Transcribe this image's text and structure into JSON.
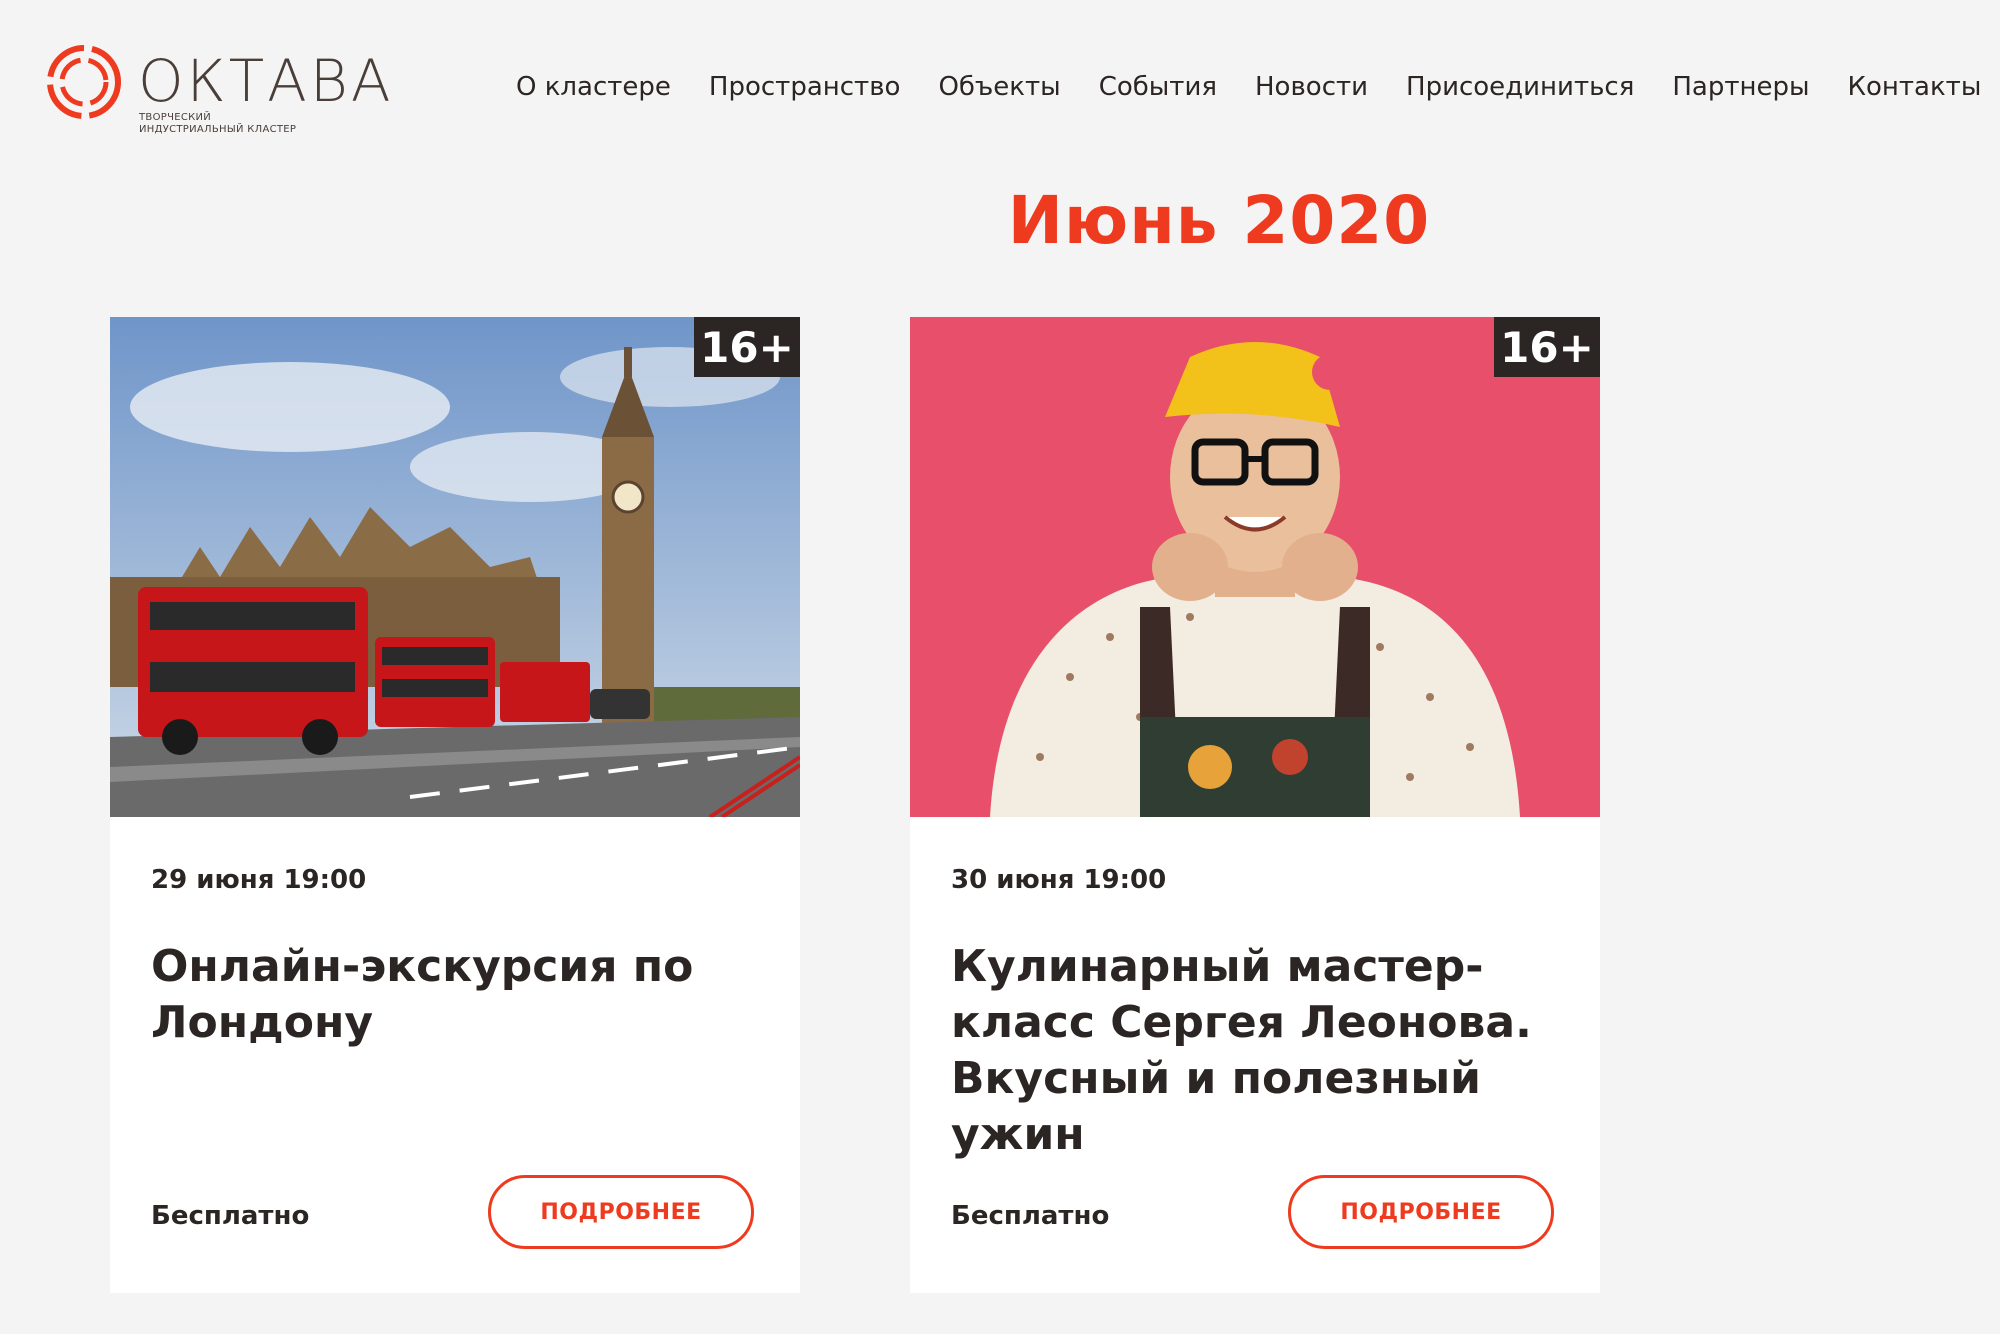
{
  "header": {
    "logo_word": "ОКТАВА",
    "logo_sub_line1": "ТВОРЧЕСКИЙ",
    "logo_sub_line2": "ИНДУСТРИАЛЬНЫЙ КЛАСТЕР",
    "nav": [
      "О кластере",
      "Пространство",
      "Объекты",
      "События",
      "Новости",
      "Присоединиться",
      "Партнеры",
      "Контакты"
    ]
  },
  "month_title": "Июнь 2020",
  "events": [
    {
      "age": "16+",
      "date": "29 июня 19:00",
      "title": "Онлайн-экскурсия по Лондону",
      "price": "Бесплатно",
      "button": "ПОДРОБНЕЕ",
      "image": "london-big-ben-red-bus-photo"
    },
    {
      "age": "16+",
      "date": "30 июня 19:00",
      "title": "Кулинарный мастер-класс Сергея Леонова. Вкусный и полезный ужин",
      "price": "Бесплатно",
      "button": "ПОДРОБНЕЕ",
      "image": "chef-portrait-pink-background-photo"
    }
  ],
  "colors": {
    "accent": "#ee3a1f",
    "text": "#2b2523",
    "background": "#f4f4f4"
  }
}
